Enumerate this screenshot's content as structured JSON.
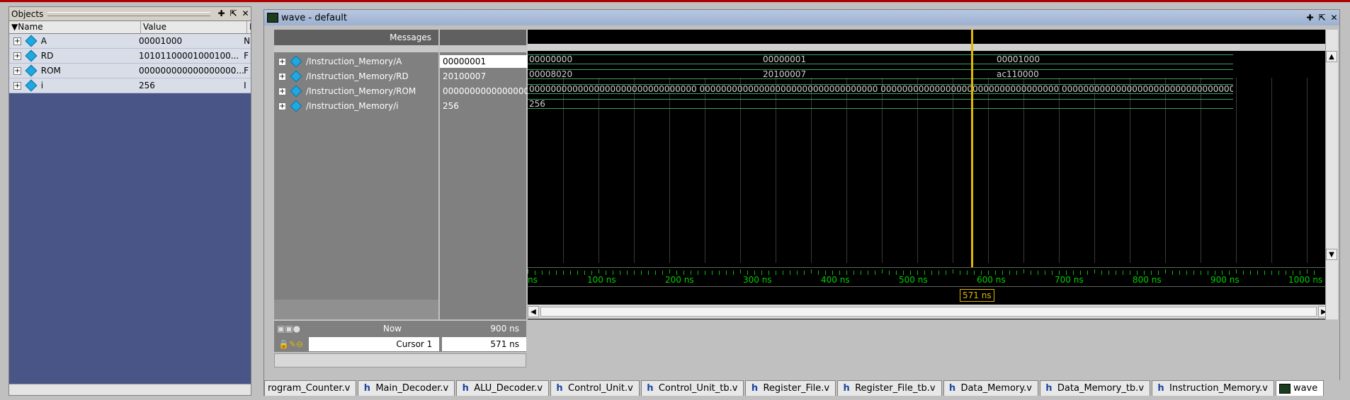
{
  "objects": {
    "title": "Objects",
    "columns": [
      "Name",
      "Value",
      "I"
    ],
    "rows": [
      {
        "name": "A",
        "value": "00001000",
        "kind": "N"
      },
      {
        "name": "RD",
        "value": "10101100001000100...",
        "kind": "F"
      },
      {
        "name": "ROM",
        "value": "000000000000000000...",
        "kind": "F"
      },
      {
        "name": "i",
        "value": "256",
        "kind": "I"
      }
    ]
  },
  "wave": {
    "title": "wave - default",
    "messages_header": "Messages",
    "signals": [
      {
        "path": "/Instruction_Memory/A",
        "value": "00000001"
      },
      {
        "path": "/Instruction_Memory/RD",
        "value": "20100007"
      },
      {
        "path": "/Instruction_Memory/ROM",
        "value": "000000000000000000"
      },
      {
        "path": "/Instruction_Memory/i",
        "value": "256"
      }
    ],
    "track_labels": {
      "A": [
        "00000000",
        "00000001",
        "00001000"
      ],
      "RD": [
        "00008020",
        "20100007",
        "ac110000"
      ],
      "ROM": "0000000000000000000000000000000 000000000000000000000000000000000 000000000000000000000000000000000 000000000000000000000000000000000...",
      "i": "256"
    },
    "now_label": "Now",
    "now_value": "900 ns",
    "cursor_label": "Cursor 1",
    "cursor_value": "571 ns",
    "cursor_flag": "571 ns",
    "timeline": [
      "ns",
      "100 ns",
      "200 ns",
      "300 ns",
      "400 ns",
      "500 ns",
      "600 ns",
      "700 ns",
      "800 ns",
      "900 ns",
      "1000 ns"
    ],
    "cursor_color": "#e0b800",
    "wave_color": "#3fa060"
  },
  "tabs": [
    {
      "label": "rogram_Counter.v",
      "icon": "none"
    },
    {
      "label": "Main_Decoder.v",
      "icon": "h"
    },
    {
      "label": "ALU_Decoder.v",
      "icon": "h"
    },
    {
      "label": "Control_Unit.v",
      "icon": "h"
    },
    {
      "label": "Control_Unit_tb.v",
      "icon": "h"
    },
    {
      "label": "Register_File.v",
      "icon": "h"
    },
    {
      "label": "Register_File_tb.v",
      "icon": "h"
    },
    {
      "label": "Data_Memory.v",
      "icon": "h"
    },
    {
      "label": "Data_Memory_tb.v",
      "icon": "h"
    },
    {
      "label": "Instruction_Memory.v",
      "icon": "h"
    },
    {
      "label": "wave",
      "icon": "wave"
    }
  ]
}
